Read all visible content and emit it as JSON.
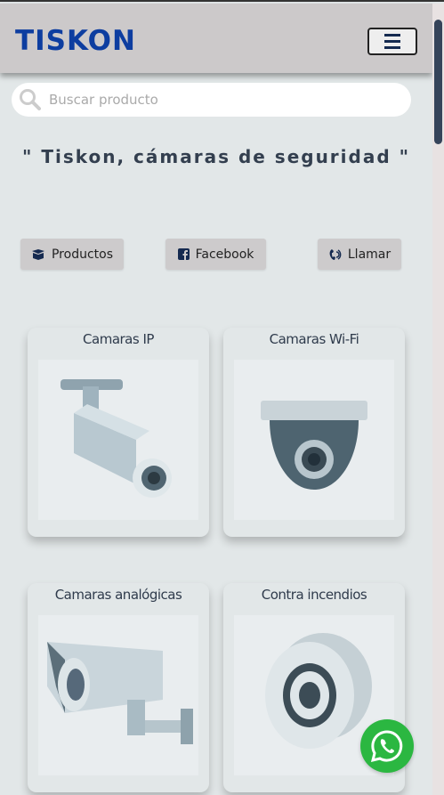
{
  "header": {
    "logo": "TISKON",
    "menu_icon": "hamburger-icon"
  },
  "search": {
    "placeholder": "Buscar producto"
  },
  "tagline": "\" Tiskon, cámaras de seguridad \"",
  "actions": [
    {
      "label": "Productos",
      "icon": "box-icon"
    },
    {
      "label": "Facebook",
      "icon": "facebook-icon"
    },
    {
      "label": "Llamar",
      "icon": "phone-icon"
    }
  ],
  "categories": [
    {
      "title": "Camaras IP"
    },
    {
      "title": "Camaras Wi-Fi"
    },
    {
      "title": "Camaras analógicas"
    },
    {
      "title": "Contra incendios"
    }
  ],
  "colors": {
    "brand": "#0d3da0",
    "whatsapp": "#2bb741"
  }
}
